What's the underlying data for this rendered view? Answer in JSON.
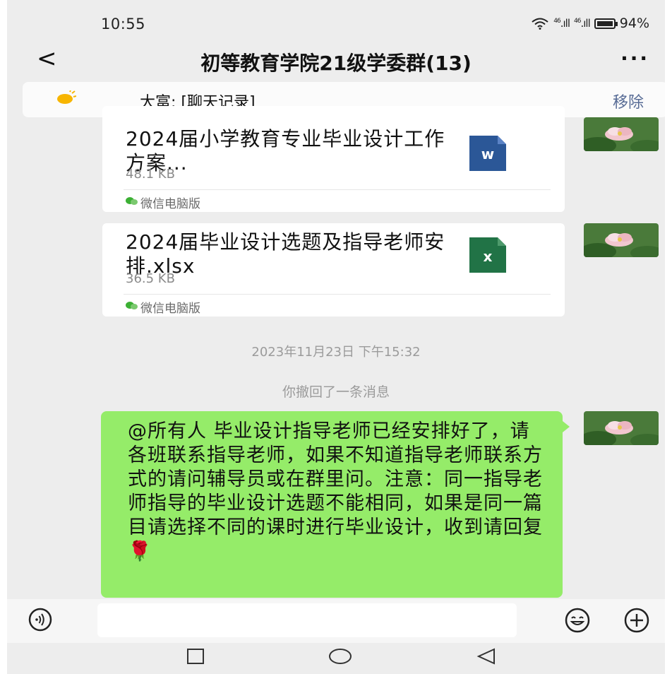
{
  "status_bar": {
    "time": "10:55",
    "signal_1": "46",
    "signal_2": "46",
    "battery": "94%"
  },
  "header": {
    "back": "<",
    "title": "初等教育学院21级学委群(13)",
    "more": "···"
  },
  "pinned": {
    "text": "大富: [聊天记录]",
    "remove_label": "移除"
  },
  "messages": [
    {
      "type": "file",
      "file_name": "2024届小学教育专业毕业设计工作方案...",
      "file_size": "48.1 KB",
      "source": "微信电脑版",
      "file_icon": "word-doc-icon",
      "icon_letter": "W",
      "icon_color": "#2b5797"
    },
    {
      "type": "file",
      "file_name": "2024届毕业设计选题及指导老师安排.xlsx",
      "file_size": "36.5 KB",
      "source": "微信电脑版",
      "file_icon": "excel-sheet-icon",
      "icon_letter": "X",
      "icon_color": "#217346"
    },
    {
      "type": "timestamp",
      "text": "2023年11月23日 下午15:32"
    },
    {
      "type": "system",
      "text": "你撤回了一条消息"
    },
    {
      "type": "text",
      "text": "@所有人 毕业设计指导老师已经安排好了，请各班联系指导老师，如果不知道指导老师联系方式的请问辅导员或在群里问。注意：同一指导老师指导的毕业设计选题不能相同，如果是同一篇目请选择不同的课时进行毕业设计，收到请回复🌹",
      "bubble_color": "#95ec69"
    }
  ],
  "input_bar": {
    "voice_icon": "voice-icon",
    "emoji_icon": "emoji-icon",
    "plus_icon": "plus-icon"
  },
  "colors": {
    "background": "#ededed",
    "link": "#576b95",
    "self_bubble": "#95ec69"
  }
}
